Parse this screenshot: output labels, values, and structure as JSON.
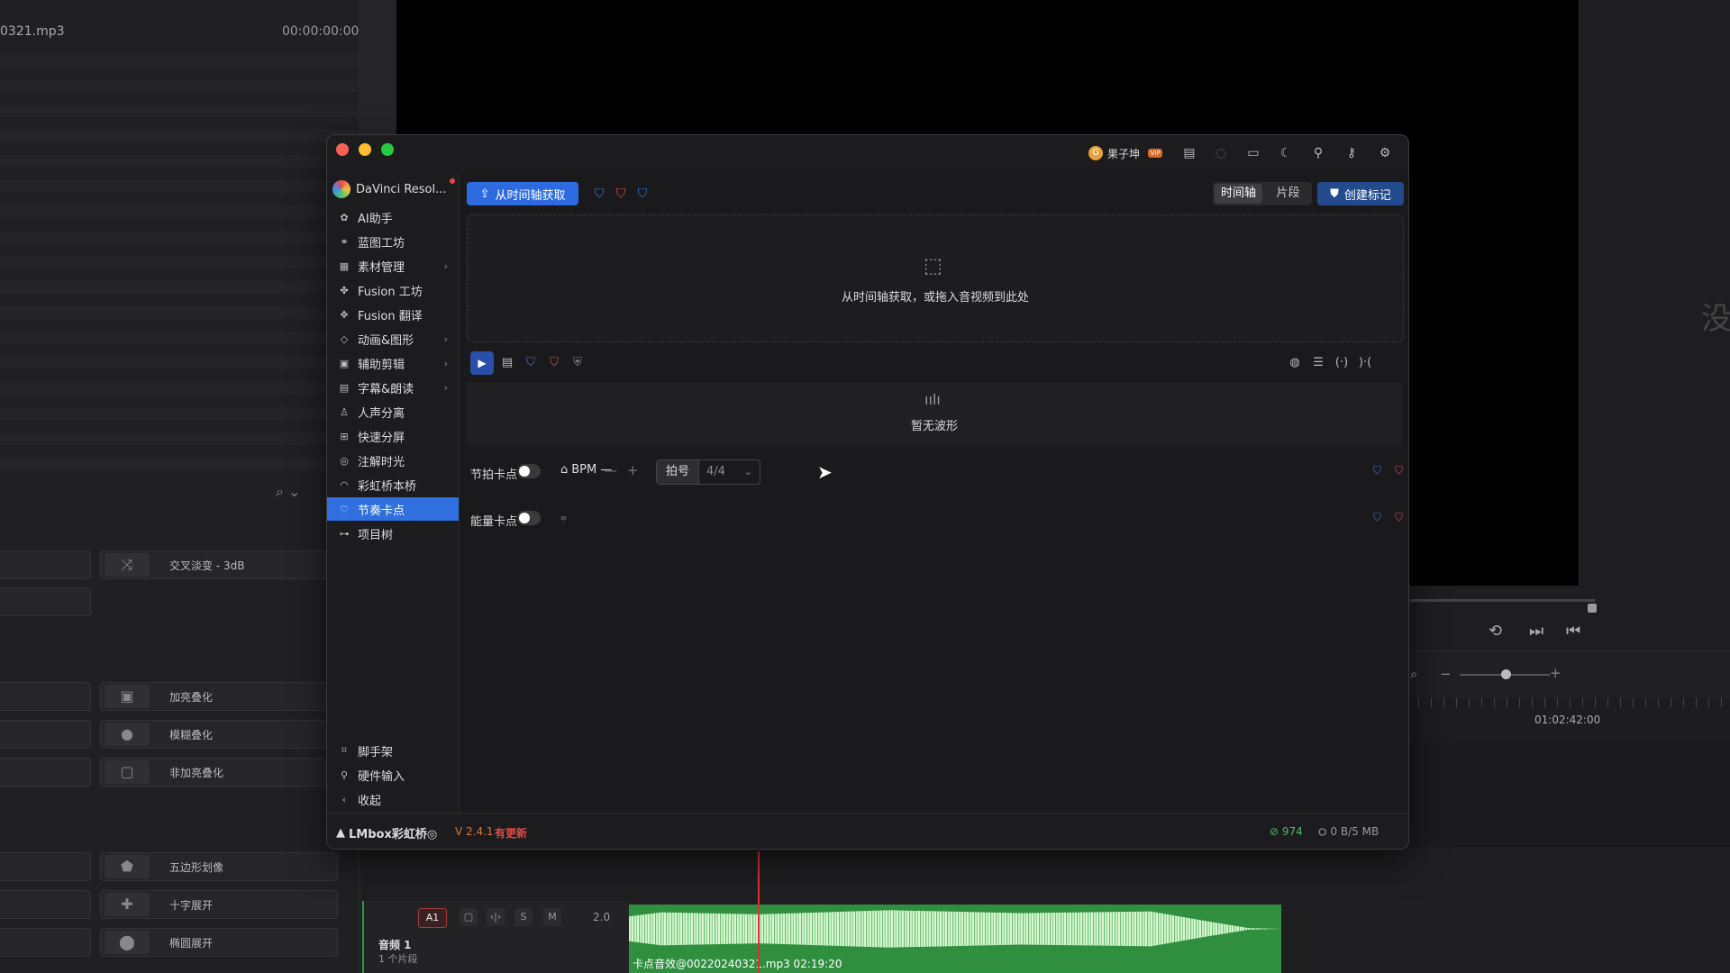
{
  "background": {
    "file_name": "0321.mp3",
    "file_time": "00:00:00:00",
    "right_edge_char": "没",
    "viewer_controls": [
      "⟲",
      "⏭",
      "⏮"
    ],
    "timecode": "01:02:42:00",
    "effects": [
      {
        "label": "交叉淡变 - 3dB",
        "icon": "crossfade-icon"
      },
      {
        "label": "加亮叠化",
        "icon": "additive-dissolve-icon"
      },
      {
        "label": "模糊叠化",
        "icon": "blur-dissolve-icon"
      },
      {
        "label": "非加亮叠化",
        "icon": "non-additive-dissolve-icon"
      },
      {
        "label": "五边形划像",
        "icon": "pentagon-iris-icon"
      },
      {
        "label": "十字展开",
        "icon": "cross-iris-icon"
      },
      {
        "label": "椭圆展开",
        "icon": "oval-iris-icon"
      }
    ],
    "track": {
      "tag": "A1",
      "solo": "S",
      "mute": "M",
      "value": "2.0",
      "name": "音频 1",
      "sub": "1 个片段",
      "clip_label": "卡点音效@00220240321.mp3  02:19:20"
    }
  },
  "titlebar": {
    "user_name": "果子坤",
    "user_badge": "VIP",
    "avatar_letter": "G"
  },
  "sidebar": {
    "app_name": "DaVinci Resol...",
    "items": [
      {
        "label": "AI助手",
        "icon": "✿",
        "chevron": false
      },
      {
        "label": "蓝图工坊",
        "icon": "⚭",
        "chevron": false
      },
      {
        "label": "素材管理",
        "icon": "▦",
        "chevron": true
      },
      {
        "label": "Fusion 工坊",
        "icon": "✤",
        "chevron": false
      },
      {
        "label": "Fusion 翻译",
        "icon": "✥",
        "chevron": false
      },
      {
        "label": "动画&图形",
        "icon": "◇",
        "chevron": true
      },
      {
        "label": "辅助剪辑",
        "icon": "▣",
        "chevron": true
      },
      {
        "label": "字幕&朗读",
        "icon": "▤",
        "chevron": true
      },
      {
        "label": "人声分离",
        "icon": "♙",
        "chevron": false
      },
      {
        "label": "快速分屏",
        "icon": "⊞",
        "chevron": false
      },
      {
        "label": "注解时光",
        "icon": "◎",
        "chevron": false
      },
      {
        "label": "彩虹桥本桥",
        "icon": "◠",
        "chevron": false
      },
      {
        "label": "节奏卡点",
        "icon": "♡",
        "chevron": false,
        "active": true
      },
      {
        "label": "项目树",
        "icon": "⊶",
        "chevron": false
      }
    ],
    "bottom_items": [
      {
        "label": "脚手架",
        "icon": "⌗"
      },
      {
        "label": "硬件输入",
        "icon": "⚲"
      },
      {
        "label": "收起",
        "icon": "‹"
      }
    ]
  },
  "toolbar": {
    "fetch_label": "从时间轴获取",
    "seg_timeline": "时间轴",
    "seg_clip": "片段",
    "create_marker_label": "创建标记"
  },
  "dropzone": {
    "text": "从时间轴获取，或拖入音视频到此处"
  },
  "waveform": {
    "empty_text": "暂无波形"
  },
  "beat_row": {
    "label": "节拍卡点",
    "bpm_label": "BPM",
    "bpm_value": "—",
    "minus": "—",
    "plus": "+",
    "meter_label": "拍号",
    "meter_value": "4/4"
  },
  "energy_row": {
    "label": "能量卡点"
  },
  "statusbar": {
    "brand": "LMbox彩虹桥◎",
    "version": "V 2.4.1",
    "update": "有更新",
    "count": "974",
    "memory": "0 B/5 MB"
  },
  "colors": {
    "accent": "#2e6be0",
    "close": "#ff5f57",
    "minimize": "#febc2e",
    "zoom": "#28c840",
    "marker_blue": "#3b6fd8",
    "marker_red": "#d84848"
  }
}
